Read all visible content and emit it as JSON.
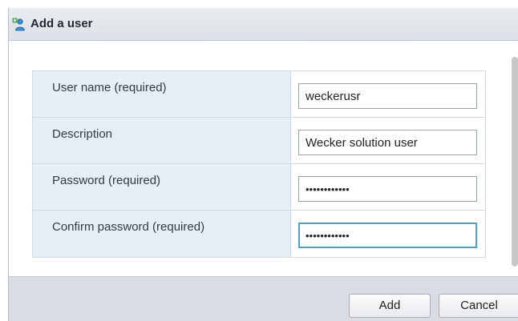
{
  "dialog": {
    "title": "Add a user",
    "title_icon": "add-user-icon"
  },
  "form": {
    "fields": [
      {
        "label": "User name (required)",
        "value": "weckerusr",
        "type": "text"
      },
      {
        "label": "Description",
        "value": "Wecker solution user",
        "type": "text"
      },
      {
        "label": "Password (required)",
        "value": "••••••••••••",
        "type": "password"
      },
      {
        "label": "Confirm password (required)",
        "value": "••••••••••••",
        "type": "password",
        "focused": true
      }
    ]
  },
  "footer": {
    "add_label": "Add",
    "cancel_label": "Cancel"
  },
  "colors": {
    "title_bar": "#dde2e8",
    "label_cell": "#e6eef6",
    "focus_border": "#4aa3c9",
    "footer": "#d9dde3"
  }
}
